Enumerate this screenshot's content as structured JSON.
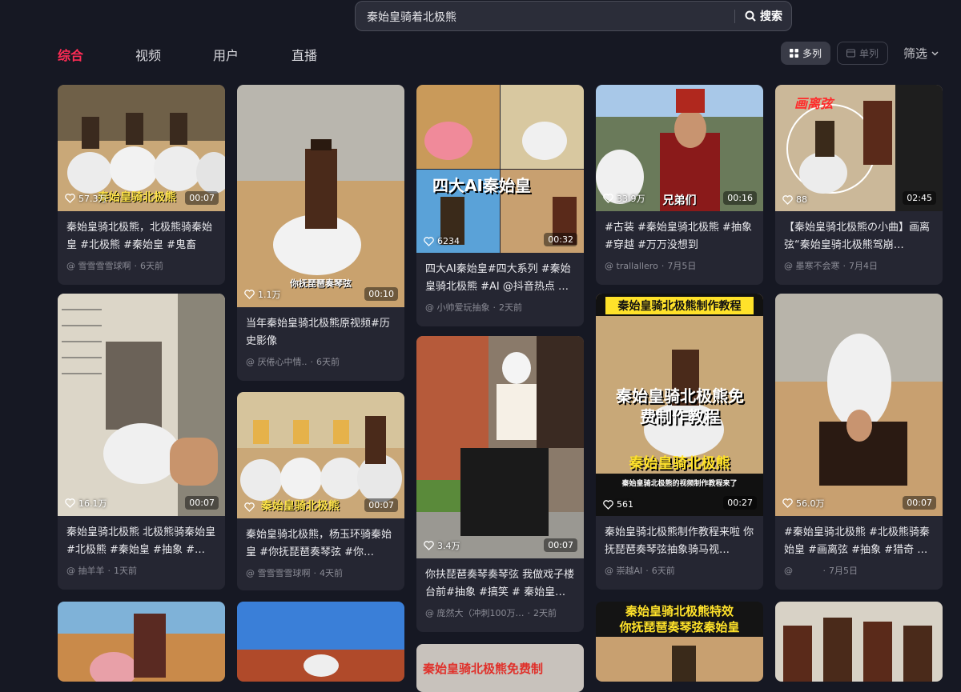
{
  "search": {
    "query": "秦始皇骑着北极熊",
    "button_label": "搜索"
  },
  "tabs": [
    "综合",
    "视频",
    "用户",
    "直播"
  ],
  "layout": {
    "multi_label": "多列",
    "single_label": "单列",
    "filter_label": "筛选"
  },
  "colors": {
    "accent": "#fe2c55",
    "background": "#161823",
    "card": "#252632",
    "muted": "#8a8b95"
  },
  "cards": [
    {
      "likes": "57.3万",
      "duration": "00:07",
      "overlay": "秦始皇骑北极熊",
      "desc": "秦始皇骑北极熊，北极熊骑秦始皇 #北极熊 #秦始皇 #鬼畜",
      "author": "雪雪雪雪球啊",
      "time": "6天前"
    },
    {
      "likes": "1.1万",
      "duration": "00:10",
      "overlay": "你抚琵琶奏琴弦",
      "desc": "当年秦始皇骑北极熊原视频#历史影像",
      "author": "厌倦心中情..",
      "time": "6天前"
    },
    {
      "likes": "6234",
      "duration": "00:32",
      "overlay": "四大AI秦始皇",
      "desc": "四大AI秦始皇#四大系列 #秦始皇骑北极熊 #AI @抖音热点 …",
      "author": "小帅爱玩抽象",
      "time": "2天前"
    },
    {
      "likes": "33.9万",
      "duration": "00:16",
      "overlay": "兄弟们",
      "desc": "#古装 #秦始皇骑北极熊 #抽象 #穿越 #万万没想到",
      "author": "trallallero",
      "time": "7月5日"
    },
    {
      "likes": "88",
      "duration": "02:45",
      "overlay": "画离弦",
      "desc": "【秦始皇骑北极熊の小曲】画离弦“秦始皇骑北极熊驾崩…",
      "author": "墨寒不会寒",
      "time": "7月4日"
    },
    {
      "likes": "16.1万",
      "duration": "00:07",
      "overlay": "",
      "desc": "秦始皇骑北极熊 北极熊骑秦始皇#北极熊 #秦始皇 #抽象 #…",
      "author": "抽羊羊",
      "time": "1天前"
    },
    {
      "likes": "",
      "duration": "00:07",
      "overlay": "秦始皇骑北极熊",
      "desc": "秦始皇骑北极熊，杨玉环骑秦始皇 #你抚琵琶奏琴弦 #你…",
      "author": "雪雪雪雪球啊",
      "time": "4天前"
    },
    {
      "likes": "3.4万",
      "duration": "00:07",
      "overlay": "",
      "desc": "你扶琵琶奏琴奏琴弦 我做戏子楼台前#抽象 #搞笑 # 秦始皇…",
      "author": "庞然大（冲刺100万…",
      "time": "2天前"
    },
    {
      "likes": "561",
      "duration": "00:27",
      "overlay": "秦始皇骑北极熊制作教程",
      "overlay2": "秦始皇骑北极熊免费制作教程",
      "overlay3": "秦始皇骑北极熊",
      "overlay4": "秦始皇骑北极熊的视频制作教程来了",
      "desc": "秦始皇骑北极熊制作教程来啦 你抚琵琶奏琴弦抽象骑马视…",
      "author": "崇越AI",
      "time": "6天前"
    },
    {
      "likes": "56.0万",
      "duration": "00:07",
      "overlay": "",
      "desc": "#秦始皇骑北极熊 #北极熊骑秦始皇 #画离弦 #抽象 #猎奇 …",
      "author": "",
      "time": "7月5日"
    },
    {
      "overlay": ""
    },
    {
      "overlay": ""
    },
    {
      "overlay": "秦始皇骑北极熊免费制"
    },
    {
      "overlay": "秦始皇骑北极熊特效",
      "overlay2": "你抚琵琶奏琴弦秦始皇"
    },
    {
      "overlay": ""
    }
  ]
}
